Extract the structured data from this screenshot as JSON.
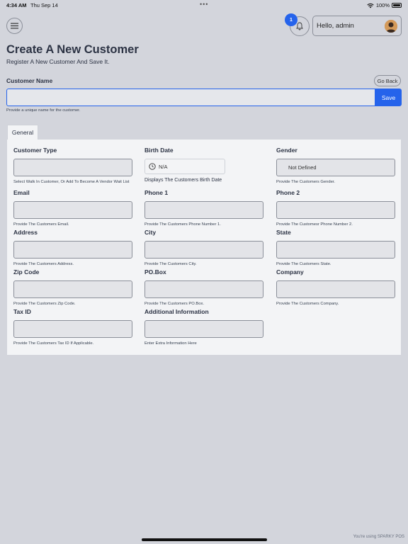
{
  "status_bar": {
    "time": "4:34 AM",
    "date": "Thu Sep 14",
    "dots": "•••",
    "battery": "100%"
  },
  "header": {
    "notification_count": "1",
    "greeting": "Hello, admin"
  },
  "page": {
    "title": "Create A New Customer",
    "subtitle": "Register A New Customer And Save It."
  },
  "customer_name": {
    "label": "Customer Name",
    "value": "",
    "help": "Provide a unique name for the customer.",
    "go_back_label": "Go Back",
    "save_label": "Save"
  },
  "tabs": [
    {
      "label": "General"
    }
  ],
  "fields": {
    "customer_type": {
      "label": "Customer Type",
      "help": "Select Walk In Customer, Or Add To Become A Vendor Wait List"
    },
    "birth_date": {
      "label": "Birth Date",
      "value": "N/A",
      "help": "Displays The Customers Birth Date"
    },
    "gender": {
      "label": "Gender",
      "value": "Not Defined",
      "help": "Provide The Customers Gender."
    },
    "email": {
      "label": "Email",
      "help": "Provide The Customers Email."
    },
    "phone1": {
      "label": "Phone 1",
      "help": "Provide The Customers Phone Number 1."
    },
    "phone2": {
      "label": "Phone 2",
      "help": "Provide The Customesr Phone Number 2."
    },
    "address": {
      "label": "Address",
      "help": "Provide The Customers Address."
    },
    "city": {
      "label": "City",
      "help": "Provide The Customers City."
    },
    "state": {
      "label": "State",
      "help": "Provide The Customers State."
    },
    "zip": {
      "label": "Zip Code",
      "help": "Provide The Customers Zip Code."
    },
    "pobox": {
      "label": "PO.Box",
      "help": "Provide The Customers PO.Box."
    },
    "company": {
      "label": "Company",
      "help": "Provide The Customers Company."
    },
    "tax_id": {
      "label": "Tax ID",
      "help": "Provide The Customers Tax ID If Applicable."
    },
    "additional_info": {
      "label": "Additional Information",
      "help": "Enter Extra Information Here"
    }
  },
  "footer": {
    "credit": "You're using SPARKY POS"
  },
  "colors": {
    "accent": "#2563eb",
    "background": "#d3d5dc",
    "panel": "#f3f4f6"
  }
}
